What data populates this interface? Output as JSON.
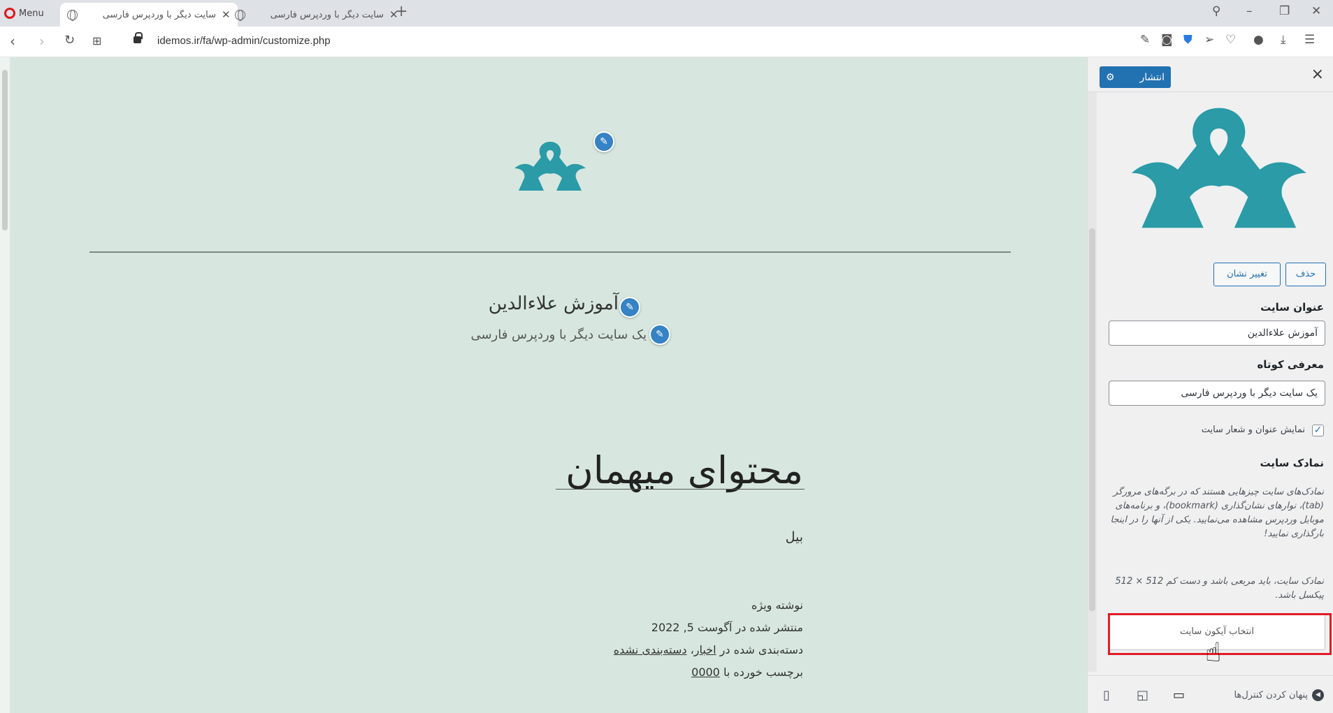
{
  "browser": {
    "menu_label": "Menu",
    "tabs": [
      {
        "title": "سایت دیگر با وردپرس فارسی",
        "active": true
      },
      {
        "title": "سایت دیگر با وردپرس فارسی",
        "active": false
      }
    ],
    "new_tab": "+",
    "url": "idemos.ir/fa/wp-admin/customize.php"
  },
  "preview": {
    "site_title": "آموزش علاءالدین",
    "site_tagline": "یک سایت دیگر با وردپرس فارسی",
    "post_title": "محتوای میهمان",
    "post_excerpt": "بیل",
    "meta_featured": "نوشته ویژه",
    "meta_published": "منتشر شده در آگوست 5, 2022",
    "meta_categorized_prefix": "دسته‌بندی شده در",
    "meta_cat1": "اخبار",
    "meta_separator": "، ",
    "meta_cat2": "دسته‌بندی نشده",
    "meta_tagged_prefix": "برچسب خورده با",
    "meta_tag": "0000",
    "accent_color": "#2a9ba7"
  },
  "panel": {
    "publish_label": "انتشار",
    "close_symbol": "×",
    "remove_button": "حذف",
    "change_logo_button": "تغییر نشان",
    "site_title_label": "عنوان سایت",
    "site_title_value": "آموزش علاءالدین",
    "tagline_label": "معرفی کوتاه",
    "tagline_value": "یک سایت دیگر با وردپرس فارسی",
    "show_title_checkbox_label": "نمایش عنوان و شعار سایت",
    "site_icon_heading": "نمادک سایت",
    "site_icon_desc": "نمادک‌های سایت چیزهایی هستند که در برگه‌های مرورگر (tab)، نوارهای نشان‌گذاری (bookmark)، و برنامه‌های موبایل وردپرس مشاهده می‌نمایید. یکی از آنها را در اینجا بارگذاری نمایید!",
    "site_icon_size_desc": "نمادک سایت، باید مربعی باشد و دست کم 512 × 512 پیکسل باشد.",
    "select_icon_button": "انتخاب آیکون سایت",
    "hide_controls_label": "پنهان کردن کنترل‌ها",
    "accent_color": "#2271b1"
  }
}
